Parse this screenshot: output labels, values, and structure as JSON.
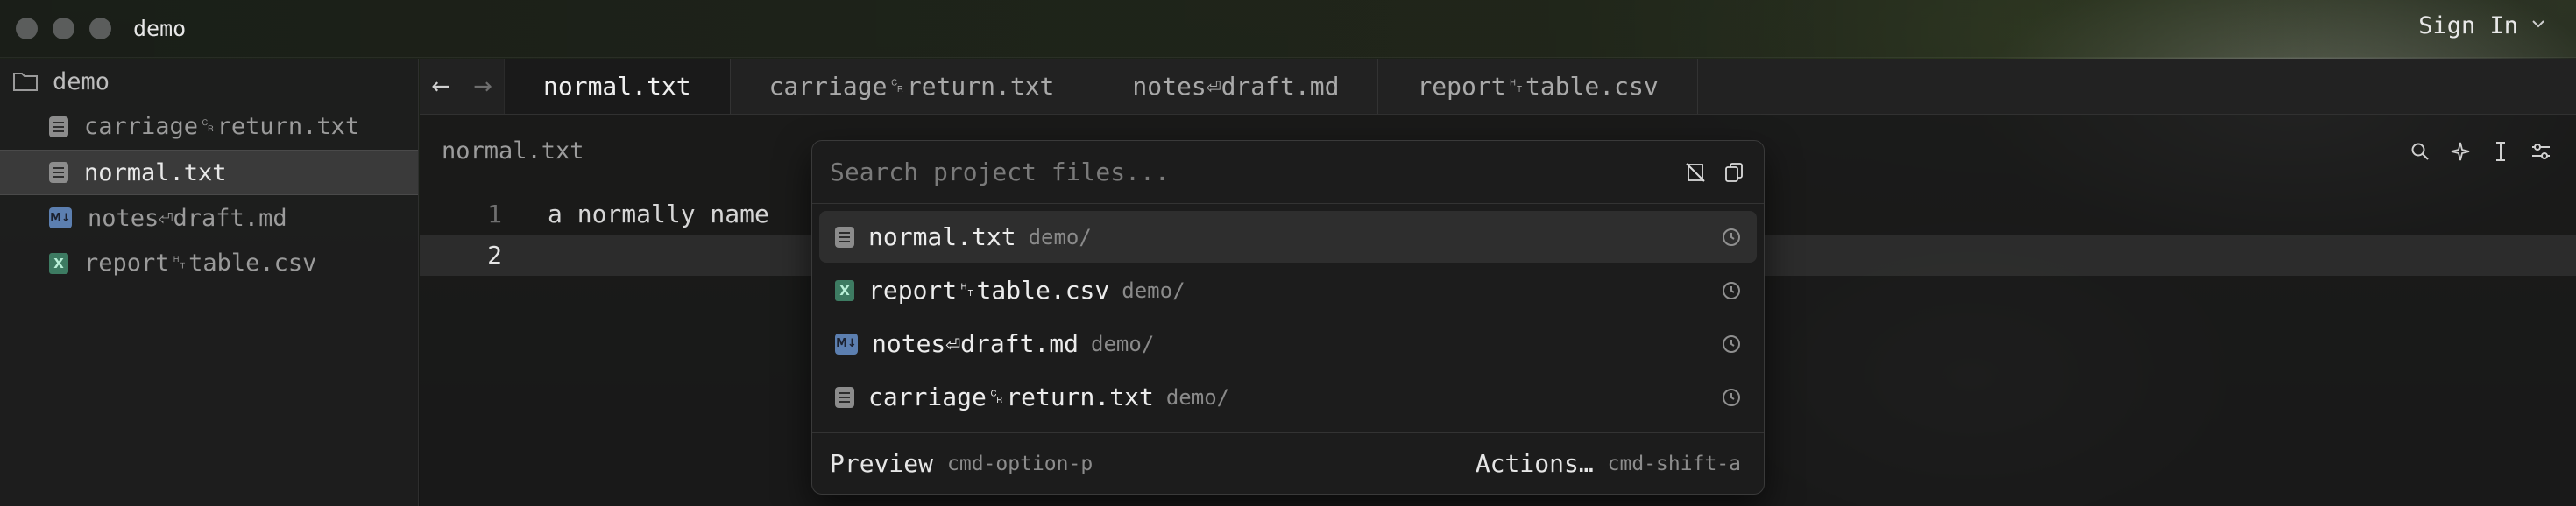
{
  "window": {
    "title": "demo",
    "sign_in": "Sign In"
  },
  "sidebar": {
    "root": "demo",
    "items": [
      {
        "label": "carriage␍return.txt",
        "type": "txt"
      },
      {
        "label": "normal.txt",
        "type": "txt",
        "selected": true
      },
      {
        "label": "notes⏎draft.md",
        "type": "md"
      },
      {
        "label": "report␉table.csv",
        "type": "csv"
      }
    ]
  },
  "tabs": [
    {
      "label": "normal.txt",
      "active": true
    },
    {
      "label": "carriage␍return.txt"
    },
    {
      "label": "notes⏎draft.md"
    },
    {
      "label": "report␉table.csv"
    }
  ],
  "nav": {
    "back": "←",
    "forward": "→"
  },
  "editor": {
    "breadcrumb": "normal.txt",
    "lines": [
      {
        "number": "1",
        "text": "a normally name"
      },
      {
        "number": "2",
        "text": ""
      }
    ]
  },
  "finder": {
    "placeholder": "Search project files...",
    "results": [
      {
        "name": "normal.txt",
        "dir": "demo/",
        "type": "txt",
        "selected": true
      },
      {
        "name": "report␉table.csv",
        "dir": "demo/",
        "type": "csv"
      },
      {
        "name": "notes⏎draft.md",
        "dir": "demo/",
        "type": "md"
      },
      {
        "name": "carriage␍return.txt",
        "dir": "demo/",
        "type": "txt"
      }
    ],
    "footer": {
      "preview_label": "Preview",
      "preview_key": "cmd-option-p",
      "actions_label": "Actions…",
      "actions_key": "cmd-shift-a"
    }
  },
  "icons": {
    "md_badge": "M↓",
    "csv_badge": "X"
  }
}
